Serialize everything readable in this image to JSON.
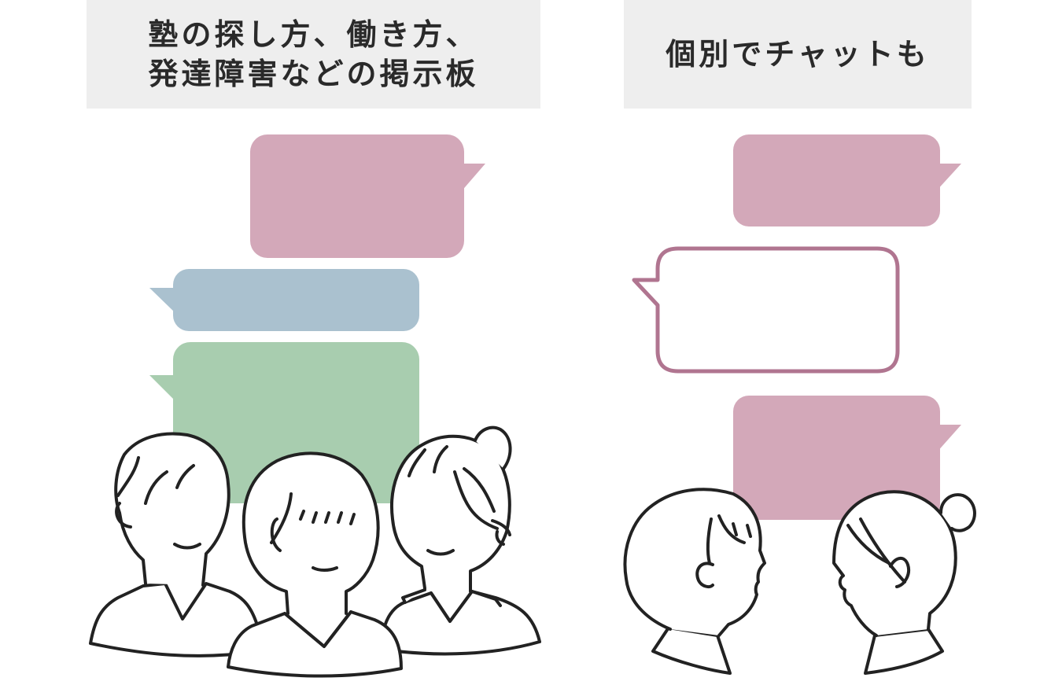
{
  "left_panel": {
    "title_line1": "塾の探し方、働き方、",
    "title_line2": "発達障害などの掲示板"
  },
  "right_panel": {
    "title": "個別でチャットも"
  },
  "colors": {
    "title_bg": "#eeeeee",
    "bubble_pink": "#d3a8b9",
    "bubble_blue": "#aac1cf",
    "bubble_green": "#a8cdaf",
    "bubble_outline": "#b07590",
    "line_art": "#222222"
  }
}
